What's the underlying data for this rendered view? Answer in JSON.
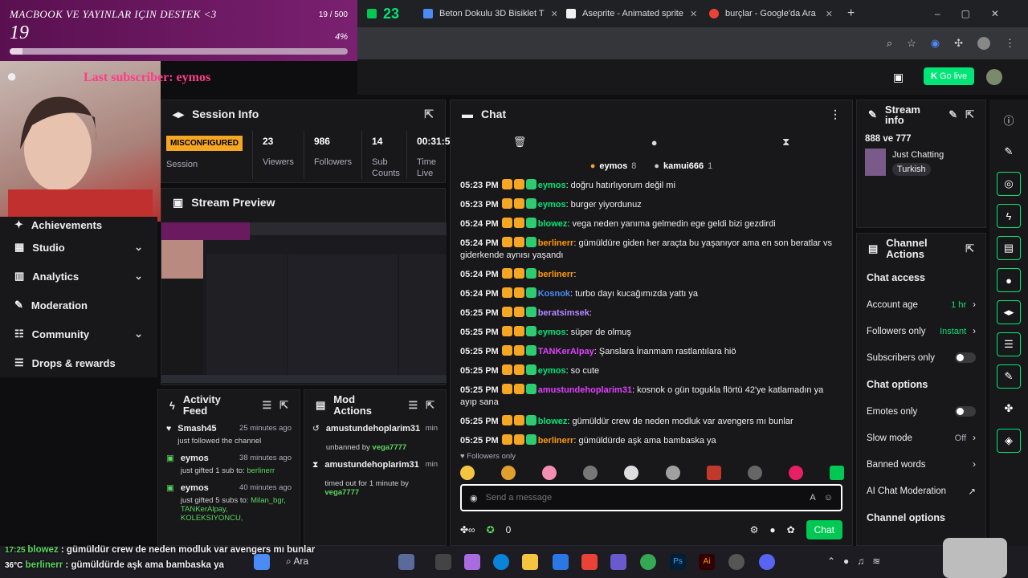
{
  "overlay": {
    "goal_title": "MACBOOK VE YAYINLAR IÇIN DESTEK <3",
    "goal_count": "19",
    "goal_fraction": "19 / 500",
    "goal_percent": "4%",
    "goal_progress": 0.038,
    "last_subscriber": "Last subscriber: eymos"
  },
  "browser": {
    "tabs": [
      {
        "label": "23",
        "color": "#00c853"
      },
      {
        "label": "Beton Dokulu 3D Bisiklet T",
        "color": "#4c8bf5"
      },
      {
        "label": "Aseprite - Animated sprite",
        "color": "#f1f1f1"
      },
      {
        "label": "burçlar - Google'da Ara",
        "color": "#ea4335"
      }
    ]
  },
  "header": {
    "go_live": "Go live"
  },
  "nav": {
    "items": [
      {
        "label": "Achievements",
        "icon": "trophy-icon",
        "chev": ""
      },
      {
        "label": "Studio",
        "icon": "film-icon",
        "chev": "⌄"
      },
      {
        "label": "Analytics",
        "icon": "chart-icon",
        "chev": "⌄"
      },
      {
        "label": "Moderation",
        "icon": "wrench-icon",
        "chev": ""
      },
      {
        "label": "Community",
        "icon": "people-icon",
        "chev": "⌄"
      },
      {
        "label": "Drops & rewards",
        "icon": "gift-icon",
        "chev": ""
      }
    ]
  },
  "session": {
    "title": "Session Info",
    "status": "MISCONFIGURED",
    "status_label": "Session",
    "stats": [
      {
        "value": "23",
        "label": "Viewers"
      },
      {
        "value": "986",
        "label": "Followers"
      },
      {
        "value": "14",
        "label": "Sub Counts"
      },
      {
        "value": "00:31:5",
        "label": "Time Live"
      }
    ]
  },
  "preview": {
    "title": "Stream Preview"
  },
  "activity": {
    "title": "Activity Feed",
    "items": [
      {
        "user": "Smash45",
        "ago": "25 minutes ago",
        "text": "just followed the channel",
        "extra": ""
      },
      {
        "user": "eymos",
        "ago": "38 minutes ago",
        "text": "just gifted 1 sub to:",
        "extra": "berlinerr"
      },
      {
        "user": "eymos",
        "ago": "40 minutes ago",
        "text": "just gifted 5 subs to:",
        "extra": "Milan_bgr, TANKerAlpay, KOLEKSIYONCU,"
      }
    ]
  },
  "modactions": {
    "title": "Mod Actions",
    "items": [
      {
        "user": "amustundehoplarim31",
        "ago": "min",
        "text": "unbanned by",
        "by": "vega7777"
      },
      {
        "user": "amustundehoplarim31",
        "ago": "min",
        "text": "timed out for 1 minute by",
        "by": "vega7777"
      }
    ]
  },
  "chat": {
    "title": "Chat",
    "top_chatters": [
      {
        "name": "eymos",
        "count": "8"
      },
      {
        "name": "kamui666",
        "count": "1"
      }
    ],
    "messages": [
      {
        "time": "05:23 PM",
        "user": "eymos",
        "color": "#00e676",
        "text": ": doğru hatırlıyorum değil mi"
      },
      {
        "time": "05:23 PM",
        "user": "eymos",
        "color": "#00e676",
        "text": ": burger yiyordunuz"
      },
      {
        "time": "05:24 PM",
        "user": "blowez",
        "color": "#00e676",
        "text": ": vega neden yanıma gelmedin ege geldi bizi gezdirdi"
      },
      {
        "time": "05:24 PM",
        "user": "berlinerr",
        "color": "#ff9800",
        "text": ": gümüldüre giden her araçta bu yaşanıyor ama en son beratlar vs giderkende aynısı yaşandı"
      },
      {
        "time": "05:24 PM",
        "user": "berlinerr",
        "color": "#ff9800",
        "text": ":"
      },
      {
        "time": "05:24 PM",
        "user": "Kosnok",
        "color": "#4c8bf5",
        "text": ": turbo dayı kucağımızda yattı ya"
      },
      {
        "time": "05:25 PM",
        "user": "beratsimsek",
        "color": "#b388ff",
        "text": ":"
      },
      {
        "time": "05:25 PM",
        "user": "eymos",
        "color": "#00e676",
        "text": ": süper de olmuş"
      },
      {
        "time": "05:25 PM",
        "user": "TANKerAlpay",
        "color": "#e040fb",
        "text": ": Şanslara İnanmam rastlantılara hiö"
      },
      {
        "time": "05:25 PM",
        "user": "eymos",
        "color": "#00e676",
        "text": ": so cute"
      },
      {
        "time": "05:25 PM",
        "user": "amustundehoplarim31",
        "color": "#e040fb",
        "text": ": kosnok o gün togukla flörtü 42'ye katlamadın ya ayıp sana"
      },
      {
        "time": "05:25 PM",
        "user": "blowez",
        "color": "#00e676",
        "text": ": gümüldür crew de neden modluk var avengers mı bunlar"
      },
      {
        "time": "05:25 PM",
        "user": "berlinerr",
        "color": "#ff9800",
        "text": ": gümüldürde aşk ama bambaska ya"
      }
    ],
    "followers_only": "Followers only",
    "placeholder": "Send a message",
    "points": "0",
    "send_label": "Chat"
  },
  "streaminfo": {
    "title": "Stream info",
    "stream_title": "888 ve 777",
    "category": "Just Chatting",
    "language": "Turkish"
  },
  "channel": {
    "title": "Channel Actions",
    "access_title": "Chat access",
    "account_age_label": "Account age",
    "account_age_value": "1 hr",
    "followers_only_label": "Followers only",
    "followers_only_value": "Instant",
    "subs_only_label": "Subscribers only",
    "options_title": "Chat options",
    "emotes_only_label": "Emotes only",
    "slow_mode_label": "Slow mode",
    "slow_mode_value": "Off",
    "banned_words_label": "Banned words",
    "ai_mod_label": "AI Chat Moderation",
    "channel_options_title": "Channel options"
  },
  "obs_chat": {
    "lines": [
      {
        "user": "blowez",
        "text": " : gümüldür crew de neden modluk var avengers mı bunlar"
      },
      {
        "user": "berlinerr",
        "text": " : gümüldürde aşk ama bambaska ya"
      }
    ]
  },
  "taskbar": {
    "search": "Ara",
    "temp": "36°C"
  }
}
